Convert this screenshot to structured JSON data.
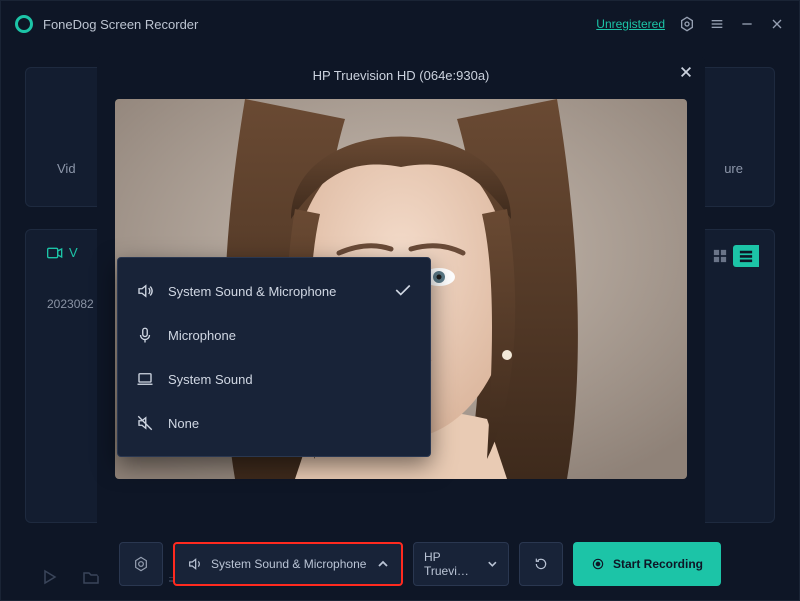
{
  "app": {
    "title": "FoneDog Screen Recorder",
    "unregistered_label": "Unregistered"
  },
  "background": {
    "left_label": "Vid",
    "right_label": "ure",
    "video_tab_label": "V",
    "date_entry": "2023082"
  },
  "modal": {
    "title": "HP Truevision HD (064e:930a)",
    "audio_button_label": "System Sound & Microphone",
    "camera_button_label": "HP Truevi…",
    "start_button_label": "Start Recording"
  },
  "dropdown": {
    "options": [
      {
        "label": "System Sound & Microphone",
        "icon": "speaker-wave",
        "selected": true
      },
      {
        "label": "Microphone",
        "icon": "mic",
        "selected": false
      },
      {
        "label": "System Sound",
        "icon": "laptop",
        "selected": false
      },
      {
        "label": "None",
        "icon": "speaker-muted",
        "selected": false
      }
    ]
  }
}
